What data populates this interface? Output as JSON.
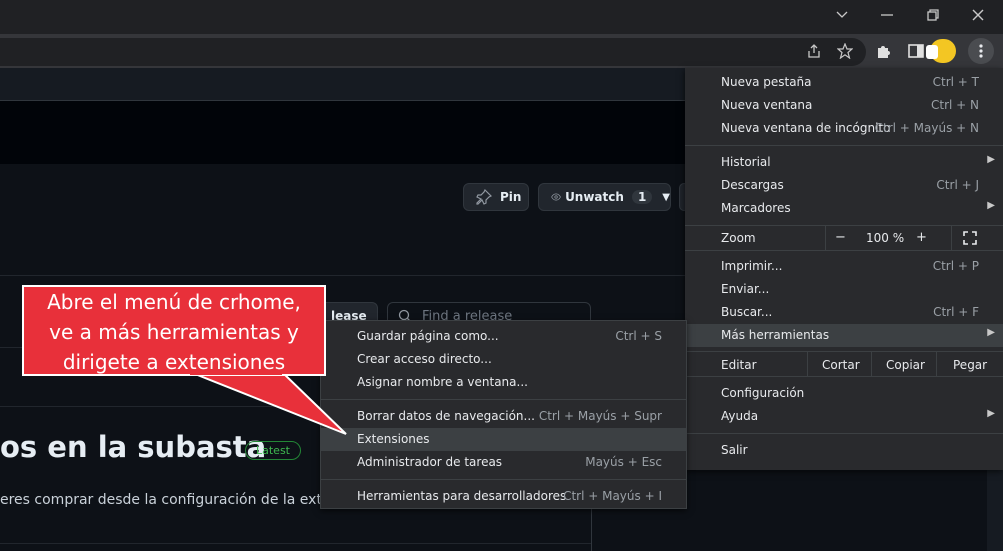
{
  "window": {
    "minimize_icon": "chevron-down-icon",
    "controls": [
      "minimize-icon",
      "restore-icon",
      "close-icon"
    ]
  },
  "page": {
    "pin_label": "Pin",
    "unwatch_label": "Unwatch",
    "unwatch_count": "1",
    "release_tab_label": "lease",
    "search_placeholder": "Find a release",
    "release_title": "os en la subasta",
    "latest_badge": "Latest",
    "description": "eres comprar desde la configuración de la ext"
  },
  "callout": {
    "text_line1": "Abre el menú de crhome,",
    "text_line2": "ve a más herramientas y",
    "text_line3": "dirigete a extensiones",
    "color": "#e8303a"
  },
  "menu": {
    "items": [
      {
        "label": "Nueva pestaña",
        "shortcut": "Ctrl + T"
      },
      {
        "label": "Nueva ventana",
        "shortcut": "Ctrl + N"
      },
      {
        "label": "Nueva ventana de incógnito",
        "shortcut": "Ctrl + Mayús + N"
      },
      {
        "label": "Historial",
        "shortcut": ""
      },
      {
        "label": "Descargas",
        "shortcut": "Ctrl + J"
      },
      {
        "label": "Marcadores",
        "shortcut": ""
      },
      {
        "label": "Zoom",
        "shortcut": ""
      },
      {
        "label": "Imprimir...",
        "shortcut": "Ctrl + P"
      },
      {
        "label": "Enviar...",
        "shortcut": ""
      },
      {
        "label": "Buscar...",
        "shortcut": "Ctrl + F"
      },
      {
        "label": "Más herramientas",
        "shortcut": ""
      },
      {
        "label": "Editar",
        "shortcut": ""
      },
      {
        "label": "Configuración",
        "shortcut": ""
      },
      {
        "label": "Ayuda",
        "shortcut": ""
      },
      {
        "label": "Salir",
        "shortcut": ""
      }
    ],
    "zoom": {
      "minus": "−",
      "value": "100 %",
      "plus": "+"
    },
    "edit": {
      "cut": "Cortar",
      "copy": "Copiar",
      "paste": "Pegar"
    }
  },
  "submenu": {
    "items": [
      {
        "label": "Guardar página como...",
        "shortcut": "Ctrl + S"
      },
      {
        "label": "Crear acceso directo...",
        "shortcut": ""
      },
      {
        "label": "Asignar nombre a ventana...",
        "shortcut": ""
      },
      {
        "label": "Borrar datos de navegación...",
        "shortcut": "Ctrl + Mayús + Supr"
      },
      {
        "label": "Extensiones",
        "shortcut": ""
      },
      {
        "label": "Administrador de tareas",
        "shortcut": "Mayús + Esc"
      },
      {
        "label": "Herramientas para desarrolladores",
        "shortcut": "Ctrl + Mayús + I"
      }
    ]
  }
}
